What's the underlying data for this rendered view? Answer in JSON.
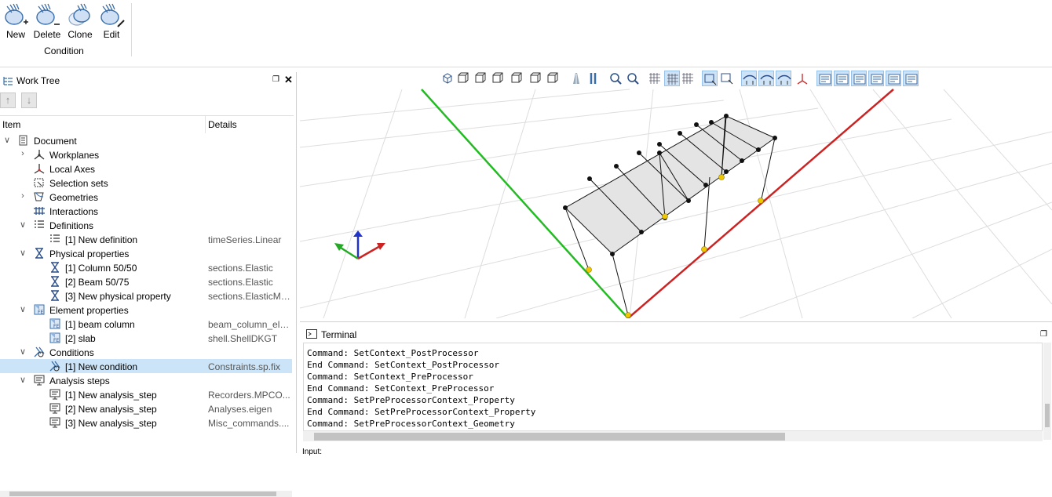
{
  "ribbon": {
    "buttons": [
      {
        "label": "New",
        "icon": "condition-new-icon"
      },
      {
        "label": "Delete",
        "icon": "condition-delete-icon"
      },
      {
        "label": "Clone",
        "icon": "condition-clone-icon"
      },
      {
        "label": "Edit",
        "icon": "condition-edit-icon"
      }
    ],
    "group_label": "Condition"
  },
  "worktree": {
    "title": "Work Tree",
    "columns": {
      "item": "Item",
      "details": "Details"
    },
    "rows": [
      {
        "label": "Document",
        "details": "",
        "icon": "document-icon"
      },
      {
        "label": "Workplanes",
        "details": "",
        "icon": "workplanes-icon"
      },
      {
        "label": "Local Axes",
        "details": "",
        "icon": "local-axes-icon"
      },
      {
        "label": "Selection sets",
        "details": "",
        "icon": "selection-sets-icon"
      },
      {
        "label": "Geometries",
        "details": "",
        "icon": "geometries-icon"
      },
      {
        "label": "Interactions",
        "details": "",
        "icon": "interactions-icon"
      },
      {
        "label": "Definitions",
        "details": "",
        "icon": "definitions-icon"
      },
      {
        "label": "[1] New definition",
        "details": "timeSeries.Linear",
        "icon": "definition-item-icon"
      },
      {
        "label": "Physical properties",
        "details": "",
        "icon": "physical-properties-icon"
      },
      {
        "label": "[1] Column 50/50",
        "details": "sections.Elastic",
        "icon": "physical-property-item-icon"
      },
      {
        "label": "[2] Beam 50/75",
        "details": "sections.Elastic",
        "icon": "physical-property-item-icon"
      },
      {
        "label": "[3] New physical property",
        "details": "sections.ElasticMe...",
        "icon": "physical-property-item-icon"
      },
      {
        "label": "Element properties",
        "details": "",
        "icon": "element-properties-icon"
      },
      {
        "label": "[1] beam column",
        "details": "beam_column_ele...",
        "icon": "element-property-item-icon"
      },
      {
        "label": "[2] slab",
        "details": "shell.ShellDKGT",
        "icon": "element-property-item-icon"
      },
      {
        "label": "Conditions",
        "details": "",
        "icon": "conditions-icon"
      },
      {
        "label": "[1] New condition",
        "details": "Constraints.sp.fix",
        "icon": "condition-item-icon"
      },
      {
        "label": "Analysis steps",
        "details": "",
        "icon": "analysis-steps-icon"
      },
      {
        "label": "[1] New analysis_step",
        "details": "Recorders.MPCO...",
        "icon": "analysis-step-item-icon"
      },
      {
        "label": "[2] New analysis_step",
        "details": "Analyses.eigen",
        "icon": "analysis-step-item-icon"
      },
      {
        "label": "[3] New analysis_step",
        "details": "Misc_commands....",
        "icon": "analysis-step-item-icon"
      }
    ]
  },
  "viewport": {
    "toolbar_icons": [
      "view-iso-icon",
      "view-front-icon",
      "view-back-icon",
      "view-left-icon",
      "view-right-icon",
      "view-top-icon",
      "view-bottom-icon",
      "perspective-icon",
      "parallel-icon",
      "zoom-fit-icon",
      "zoom-region-icon",
      "grid-icon",
      "grid-fine-icon",
      "grid-axes-icon",
      "select-box-icon",
      "select-add-icon",
      "show-nodes-icon",
      "show-lines-icon",
      "show-surfaces-icon",
      "show-axes-icon",
      "filter-1-icon",
      "filter-2-icon",
      "filter-3-icon",
      "filter-4-icon",
      "filter-5-icon",
      "filter-6-icon"
    ]
  },
  "terminal": {
    "title": "Terminal",
    "lines": [
      "Command: SetContext_PostProcessor",
      "End Command: SetContext_PostProcessor",
      "Command: SetContext_PreProcessor",
      "End Command: SetContext_PreProcessor",
      "Command: SetPreProcessorContext_Property",
      "End Command: SetPreProcessorContext_Property",
      "Command: SetPreProcessorContext_Geometry"
    ],
    "input_label": "Input:"
  },
  "colors": {
    "selection": "#cce4f7",
    "x_axis": "#cc2222",
    "y_axis": "#22aa22",
    "z_axis": "#2233cc"
  }
}
